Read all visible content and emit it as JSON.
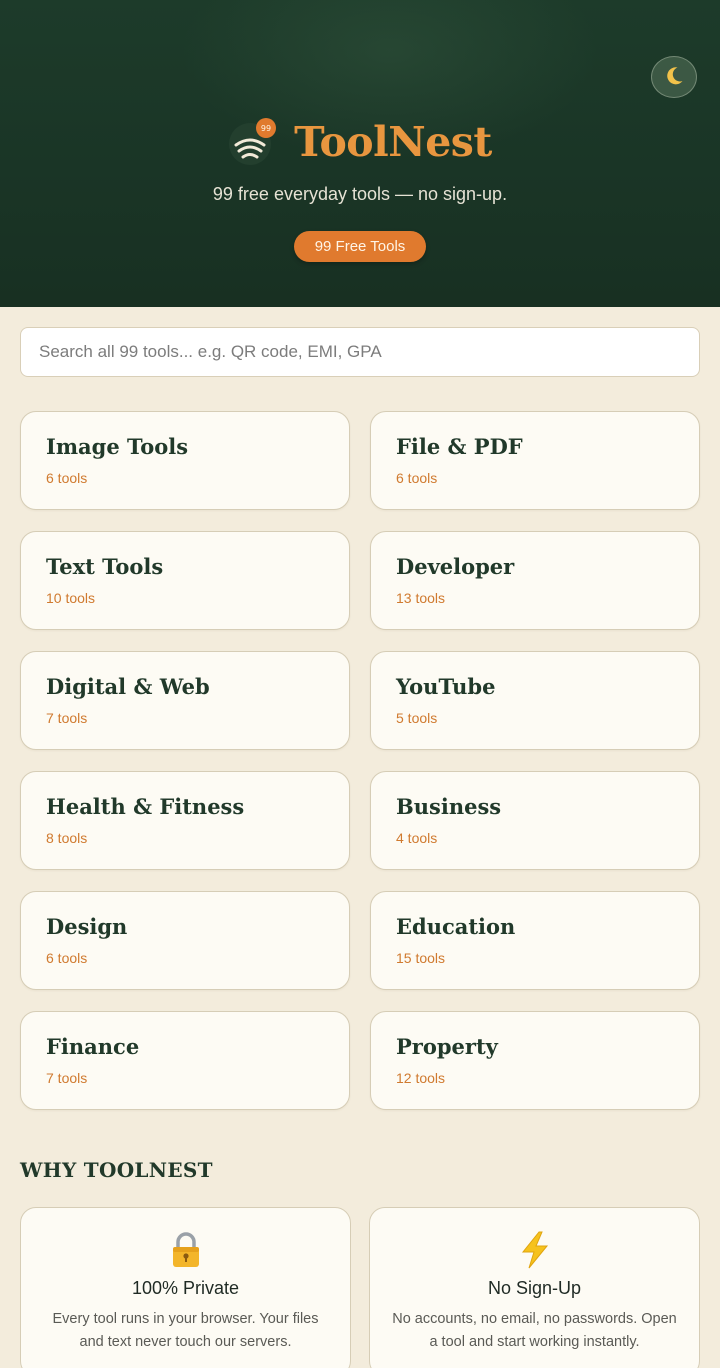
{
  "header": {
    "brand_name": "ToolNest",
    "logo_badge": "99",
    "tagline": "99 free everyday tools — no sign-up.",
    "badge_label": "99 Free Tools",
    "theme_toggle_icon": "moon-icon"
  },
  "search": {
    "placeholder": "Search all 99 tools... e.g. QR code, EMI, GPA",
    "value": ""
  },
  "categories": [
    {
      "title": "Image Tools",
      "count": "6 tools"
    },
    {
      "title": "File & PDF",
      "count": "6 tools"
    },
    {
      "title": "Text Tools",
      "count": "10 tools"
    },
    {
      "title": "Developer",
      "count": "13 tools"
    },
    {
      "title": "Digital & Web",
      "count": "7 tools"
    },
    {
      "title": "YouTube",
      "count": "5 tools"
    },
    {
      "title": "Health & Fitness",
      "count": "8 tools"
    },
    {
      "title": "Business",
      "count": "4 tools"
    },
    {
      "title": "Design",
      "count": "6 tools"
    },
    {
      "title": "Education",
      "count": "15 tools"
    },
    {
      "title": "Finance",
      "count": "7 tools"
    },
    {
      "title": "Property",
      "count": "12 tools"
    }
  ],
  "why": {
    "heading": "WHY TOOLNEST",
    "items": [
      {
        "icon": "lock-icon",
        "title": "100% Private",
        "text": "Every tool runs in your browser. Your files and text never touch our servers."
      },
      {
        "icon": "lightning-icon",
        "title": "No Sign-Up",
        "text": "No accounts, no email, no passwords. Open a tool and start working instantly."
      }
    ]
  },
  "colors": {
    "hero_bg": "#1b3827",
    "accent_orange": "#e07a2e",
    "brand_orange": "#e8963f",
    "page_bg": "#f3ecdc",
    "card_bg": "#fdfbf4",
    "heading_green": "#21392a"
  }
}
